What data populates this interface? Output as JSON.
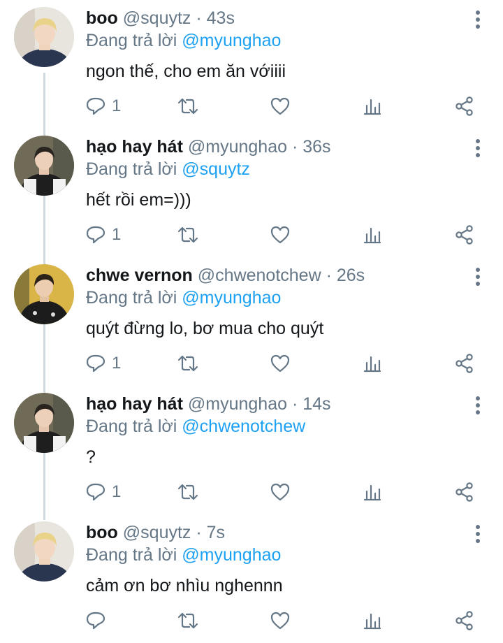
{
  "tweets": [
    {
      "name": "boo",
      "handle": "@squytz",
      "dot": "·",
      "time": "43s",
      "reply_prefix": "Đang trả lời",
      "reply_mention": "@myunghao",
      "text": "ngon thế, cho em ăn vớiiii",
      "reply_count": "1",
      "avatar_icon": "avatar-blonde-hoodie"
    },
    {
      "name": "hạo hay hát",
      "handle": "@myunghao",
      "dot": "·",
      "time": "36s",
      "reply_prefix": "Đang trả lời",
      "reply_mention": "@squytz",
      "text": "hết rồi em=)))",
      "reply_count": "1",
      "avatar_icon": "avatar-black-white-jacket"
    },
    {
      "name": "chwe vernon",
      "handle": "@chwenotchew",
      "dot": "·",
      "time": "26s",
      "reply_prefix": "Đang trả lời",
      "reply_mention": "@myunghao",
      "text": "quýt đừng lo, bơ mua cho quýt",
      "reply_count": "1",
      "avatar_icon": "avatar-dark-jacket-yellow-bg"
    },
    {
      "name": "hạo hay hát",
      "handle": "@myunghao",
      "dot": "·",
      "time": "14s",
      "reply_prefix": "Đang trả lời",
      "reply_mention": "@chwenotchew",
      "text": "?",
      "reply_count": "1",
      "avatar_icon": "avatar-black-white-jacket"
    },
    {
      "name": "boo",
      "handle": "@squytz",
      "dot": "·",
      "time": "7s",
      "reply_prefix": "Đang trả lời",
      "reply_mention": "@myunghao",
      "text": "cảm ơn bơ nhìu nghennn",
      "reply_count": "",
      "avatar_icon": "avatar-blonde-hoodie"
    }
  ],
  "colors": {
    "text": "#14171a",
    "secondary": "#657786",
    "mention": "#1da1f2",
    "thread_line": "#cfd9de"
  }
}
